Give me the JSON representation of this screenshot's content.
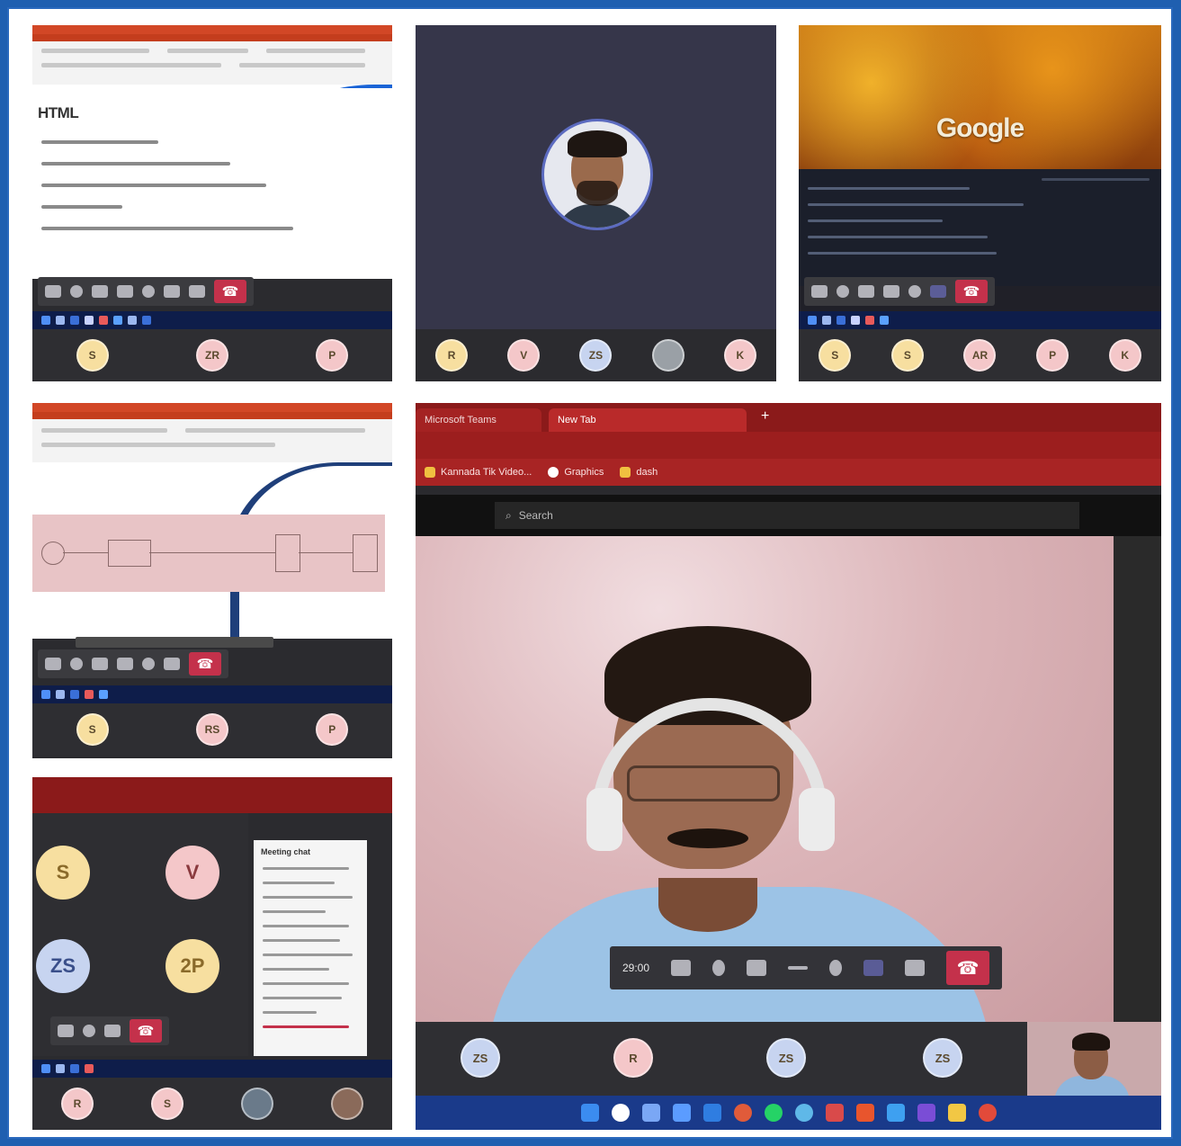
{
  "tile1": {
    "slide_heading": "HTML",
    "avatars": [
      {
        "initials": "S",
        "color": "#f7dfa0"
      },
      {
        "initials": "ZR",
        "color": "#f4c7c9"
      },
      {
        "initials": "P",
        "color": "#f4c7c9"
      }
    ]
  },
  "tile2": {
    "avatars": [
      {
        "initials": "R",
        "color": "#f7dfa0"
      },
      {
        "initials": "V",
        "color": "#f4c7c9"
      },
      {
        "initials": "ZS",
        "color": "#c7d4f0"
      },
      {
        "initials": "",
        "color": "#9aa0a6"
      },
      {
        "initials": "K",
        "color": "#f4c7c9"
      }
    ]
  },
  "tile3": {
    "brand": "Google",
    "avatars": [
      {
        "initials": "S",
        "color": "#f7dfa0"
      },
      {
        "initials": "S",
        "color": "#f7dfa0"
      },
      {
        "initials": "AR",
        "color": "#f4c7c9"
      },
      {
        "initials": "P",
        "color": "#f4c7c9"
      },
      {
        "initials": "K",
        "color": "#f4c7c9"
      }
    ]
  },
  "tile4": {
    "avatars": [
      {
        "initials": "S",
        "color": "#f7dfa0"
      },
      {
        "initials": "RS",
        "color": "#f4c7c9"
      },
      {
        "initials": "P",
        "color": "#f4c7c9"
      }
    ]
  },
  "tile5": {
    "grid": [
      {
        "initials": "S",
        "color": "#f7dfa0"
      },
      {
        "initials": "V",
        "color": "#f4c7c9"
      },
      {
        "initials": "ZS",
        "color": "#c7d4f0"
      },
      {
        "initials": "2P",
        "color": "#f7dfa0"
      }
    ],
    "chat_title": "Meeting chat",
    "strip": [
      {
        "initials": "R",
        "color": "#f4c7c9"
      },
      {
        "initials": "S",
        "color": "#f4c7c9"
      }
    ]
  },
  "tile6": {
    "tabs": [
      "Microsoft Teams",
      "New Tab"
    ],
    "bookmarks": [
      "Kannada Tik Video...",
      "Graphics",
      "dash"
    ],
    "search_placeholder": "Search",
    "meeting_time": "29:00",
    "strip": [
      {
        "initials": "ZS",
        "color": "#c7d4f0"
      },
      {
        "initials": "R",
        "color": "#f4c7c9"
      },
      {
        "initials": "ZS",
        "color": "#c7d4f0"
      },
      {
        "initials": "ZS",
        "color": "#c7d4f0"
      }
    ]
  },
  "colors": {
    "teams_hangup": "#c4314b",
    "teams_accent": "#6264a7",
    "browser_red": "#8b1a1a",
    "frame_blue": "#1f5fb0"
  }
}
